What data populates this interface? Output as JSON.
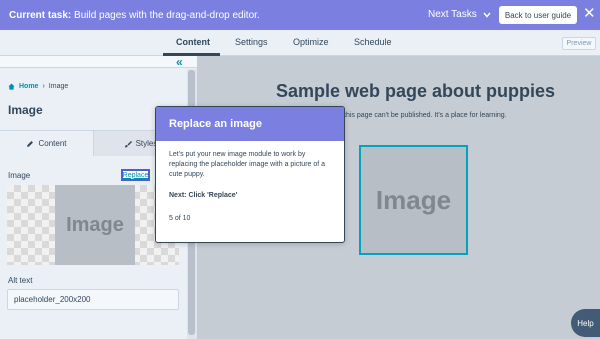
{
  "taskbar": {
    "label": "Current task:",
    "task": "Build pages with the drag-and-drop editor.",
    "next_tasks": "Next Tasks",
    "next_icon": "chevron-down-icon",
    "back_button": "Back to user guide",
    "close_icon": "close-icon",
    "close": "✕"
  },
  "tabs": [
    {
      "label": "Content",
      "active": true
    },
    {
      "label": "Settings",
      "active": false
    },
    {
      "label": "Optimize",
      "active": false
    },
    {
      "label": "Schedule",
      "active": false
    }
  ],
  "preview_button": "Preview",
  "sidebar": {
    "collapse_icon": "«",
    "breadcrumb": {
      "home": "Home",
      "current": "Image"
    },
    "title": "Image",
    "subtabs": {
      "content": "Content",
      "styles": "Styles"
    },
    "image_label": "Image",
    "replace_link": "Replace",
    "thumbnail_text": "Image",
    "alt_label": "Alt text",
    "alt_value": "placeholder_200x200"
  },
  "preview": {
    "heading": "Sample web page about puppies",
    "subtext": "this page can't be published. It's a place for learning.",
    "placeholder_text": "Image"
  },
  "help_button": "Help",
  "modal": {
    "title": "Replace an image",
    "body": "Let's put your new image module to work by replacing the placeholder image with a picture of a cute puppy.",
    "next": "Next: Click 'Replace'",
    "step": "5 of 10"
  },
  "colors": {
    "accent": "#7b80e0",
    "teal": "#00a4bd",
    "text": "#33475b"
  }
}
